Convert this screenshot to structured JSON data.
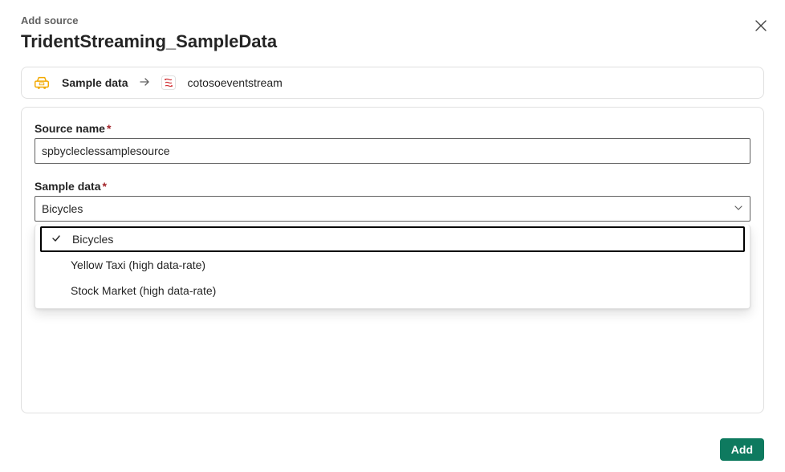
{
  "header": {
    "subtitle": "Add source",
    "title": "TridentStreaming_SampleData"
  },
  "breadcrumb": {
    "source_label": "Sample data",
    "destination_label": "cotosoeventstream"
  },
  "form": {
    "source_name": {
      "label": "Source name",
      "required": "*",
      "value": "spbycleclessamplesource"
    },
    "sample_data": {
      "label": "Sample data",
      "required": "*",
      "selected": "Bicycles",
      "options": [
        {
          "label": "Bicycles",
          "selected": true
        },
        {
          "label": "Yellow Taxi (high data-rate)",
          "selected": false
        },
        {
          "label": "Stock Market (high data-rate)",
          "selected": false
        }
      ]
    }
  },
  "footer": {
    "add_label": "Add"
  }
}
